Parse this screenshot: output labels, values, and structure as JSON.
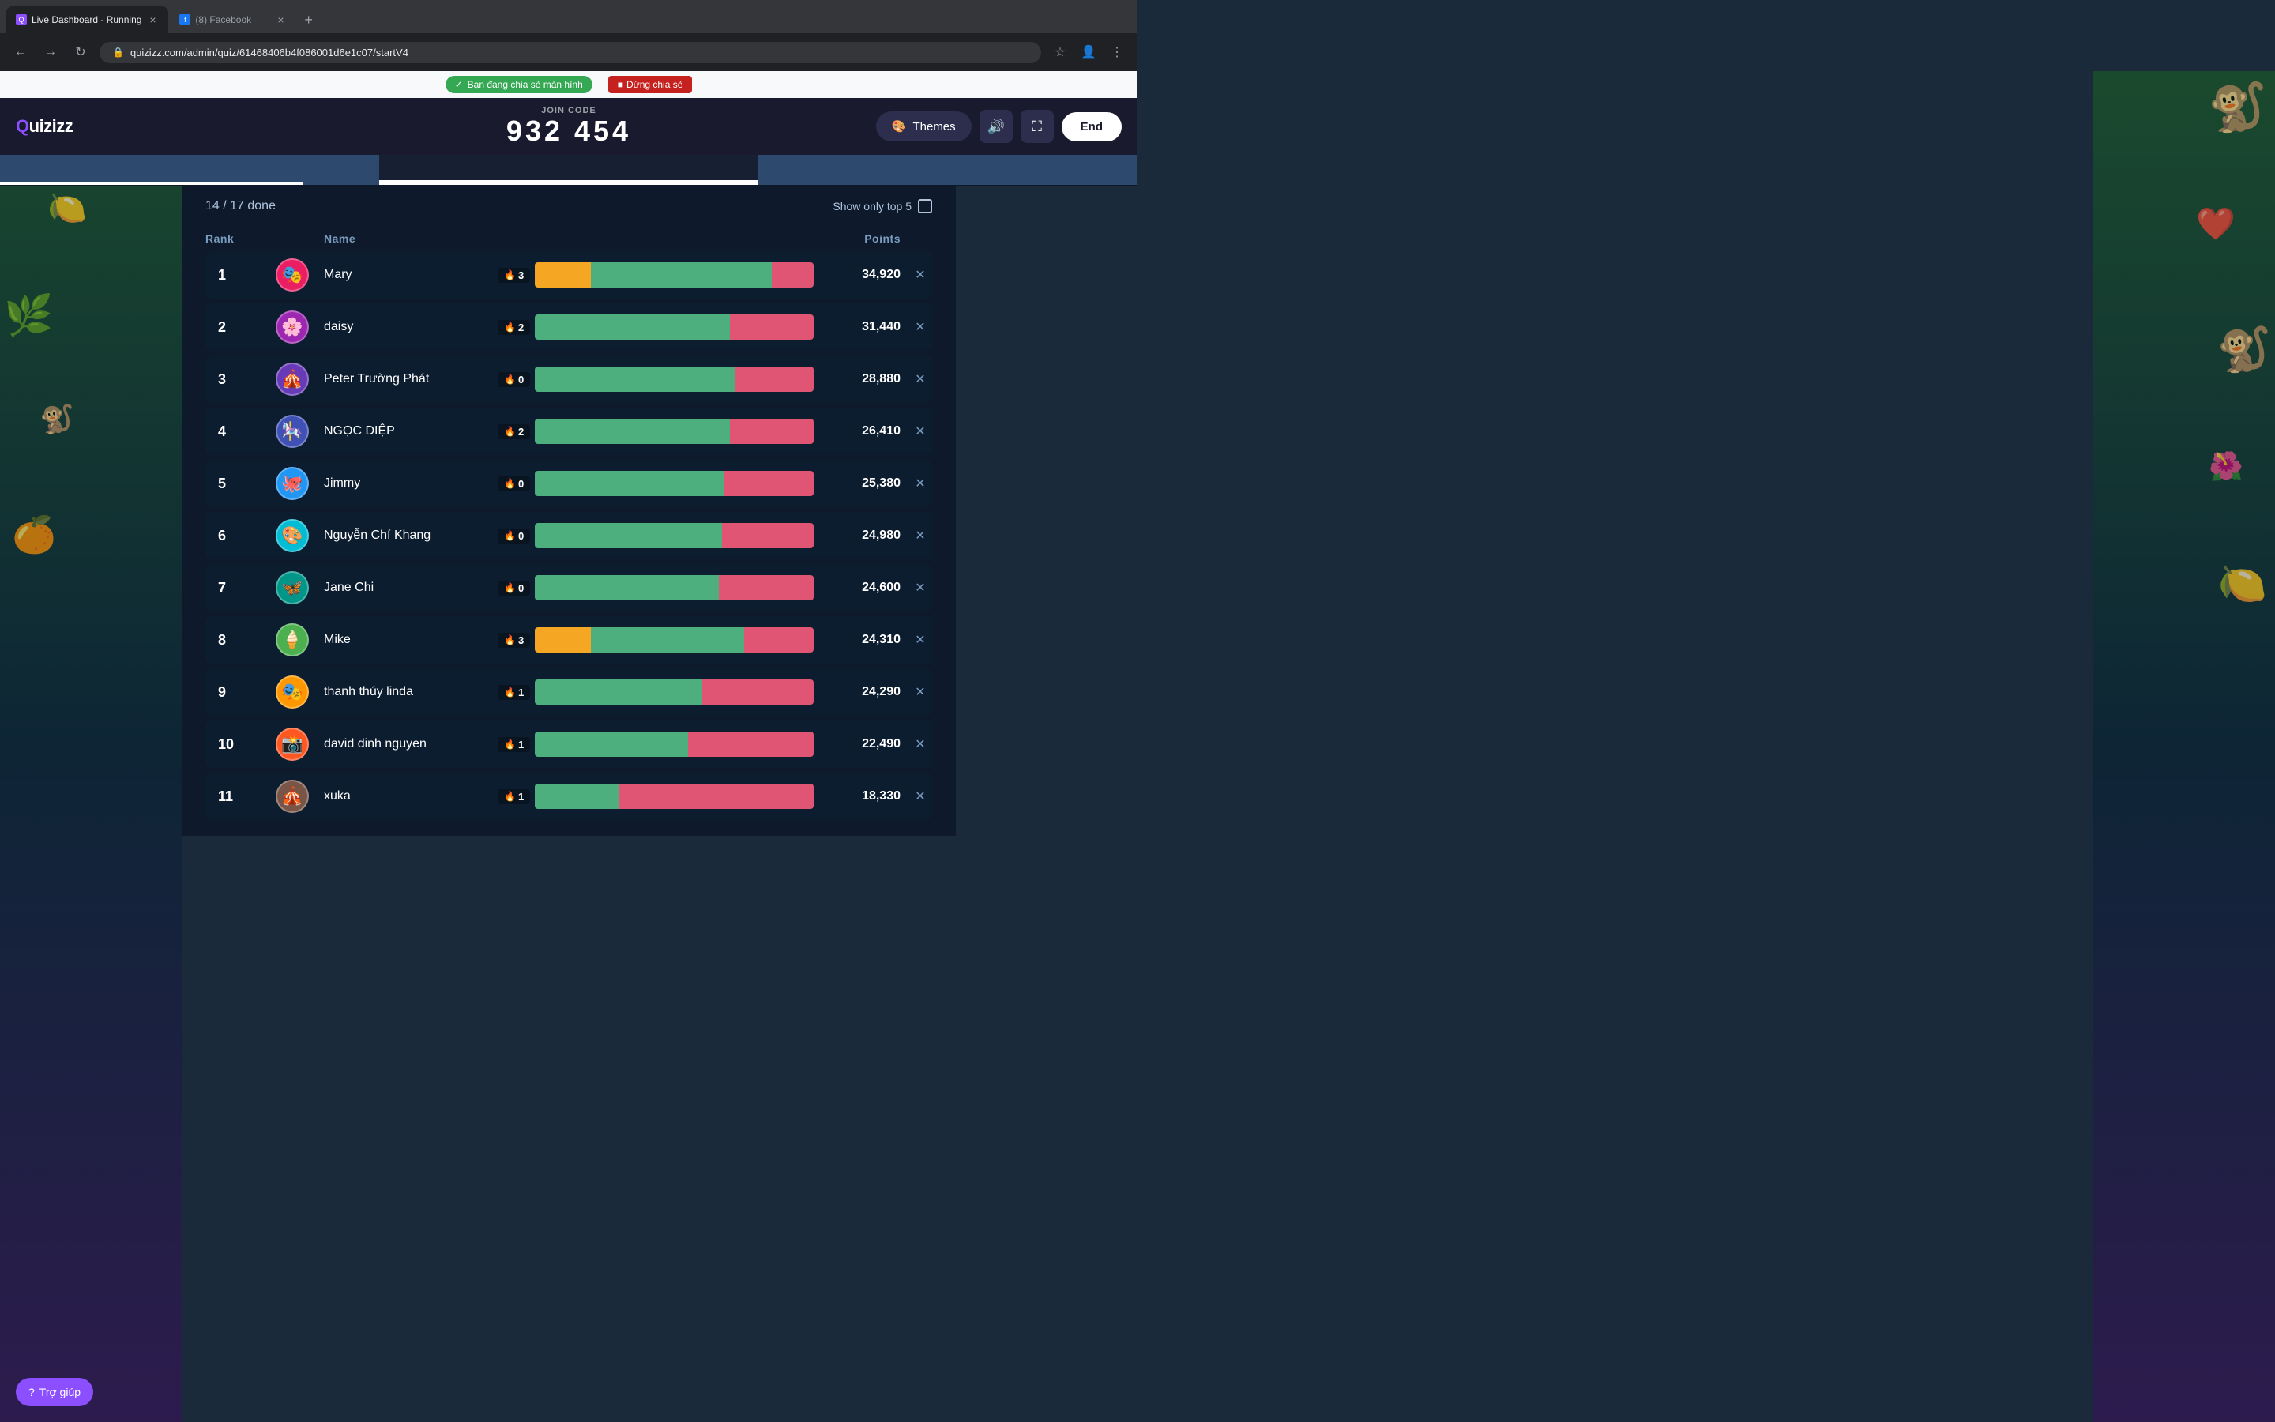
{
  "browser": {
    "tabs": [
      {
        "label": "Live Dashboard - Running",
        "favicon": "Q",
        "favicon_type": "quizizz",
        "active": true
      },
      {
        "label": "(8) Facebook",
        "favicon": "f",
        "favicon_type": "fb",
        "active": false
      }
    ],
    "address": "quizizz.com/admin/quiz/61468406b4f086001d6e1c07/startV4",
    "sharing_text": "Bạn đang chia sẻ màn hình",
    "stop_sharing": "Dừng chia sẻ"
  },
  "header": {
    "logo": "Quizizz",
    "join_code_label": "JOIN CODE",
    "join_code": "932 454",
    "themes_label": "Themes",
    "end_label": "End"
  },
  "leaderboard": {
    "progress_label": "14 / 17 done",
    "show_top_5_label": "Show only top 5",
    "columns": {
      "rank": "Rank",
      "name": "Name",
      "points": "Points"
    },
    "rows": [
      {
        "rank": 1,
        "name": "Mary",
        "streak": 3,
        "streak_type": "fire",
        "green_pct": 65,
        "orange_pct": 20,
        "red_pct": 15,
        "points": 34920,
        "avatar_emoji": "🎭"
      },
      {
        "rank": 2,
        "name": "daisy",
        "streak": 2,
        "streak_type": "fire",
        "green_pct": 70,
        "orange_pct": 0,
        "red_pct": 30,
        "points": 31440,
        "avatar_emoji": "🌸"
      },
      {
        "rank": 3,
        "name": "Peter Trường Phát",
        "streak": 0,
        "streak_type": "fire",
        "green_pct": 72,
        "orange_pct": 0,
        "red_pct": 28,
        "points": 28880,
        "avatar_emoji": "🎪"
      },
      {
        "rank": 4,
        "name": "NGỌC DIỆP",
        "streak": 2,
        "streak_type": "fire",
        "green_pct": 70,
        "orange_pct": 0,
        "red_pct": 30,
        "points": 26410,
        "avatar_emoji": "🎠"
      },
      {
        "rank": 5,
        "name": "Jimmy",
        "streak": 0,
        "streak_type": "fire",
        "green_pct": 68,
        "orange_pct": 0,
        "red_pct": 32,
        "points": 25380,
        "avatar_emoji": "🐙"
      },
      {
        "rank": 6,
        "name": "Nguyễn Chí Khang",
        "streak": 0,
        "streak_type": "fire",
        "green_pct": 67,
        "orange_pct": 0,
        "red_pct": 33,
        "points": 24980,
        "avatar_emoji": "🎨"
      },
      {
        "rank": 7,
        "name": "Jane Chi",
        "streak": 0,
        "streak_type": "fire",
        "green_pct": 66,
        "orange_pct": 0,
        "red_pct": 34,
        "points": 24600,
        "avatar_emoji": "🦋"
      },
      {
        "rank": 8,
        "name": "Mike",
        "streak": 3,
        "streak_type": "fire",
        "green_pct": 55,
        "orange_pct": 20,
        "red_pct": 25,
        "points": 24310,
        "avatar_emoji": "🍦"
      },
      {
        "rank": 9,
        "name": "thanh thúy linda",
        "streak": 1,
        "streak_type": "fire",
        "green_pct": 60,
        "orange_pct": 0,
        "red_pct": 40,
        "points": 24290,
        "avatar_emoji": "🎭"
      },
      {
        "rank": 10,
        "name": "david dinh nguyen",
        "streak": 1,
        "streak_type": "fire",
        "green_pct": 55,
        "orange_pct": 0,
        "red_pct": 45,
        "points": 22490,
        "avatar_emoji": "📸"
      },
      {
        "rank": 11,
        "name": "xuka",
        "streak": 1,
        "streak_type": "fire",
        "green_pct": 30,
        "orange_pct": 0,
        "red_pct": 70,
        "points": 18330,
        "avatar_emoji": "🎪"
      }
    ]
  },
  "help": {
    "label": "Trợ giúp"
  }
}
